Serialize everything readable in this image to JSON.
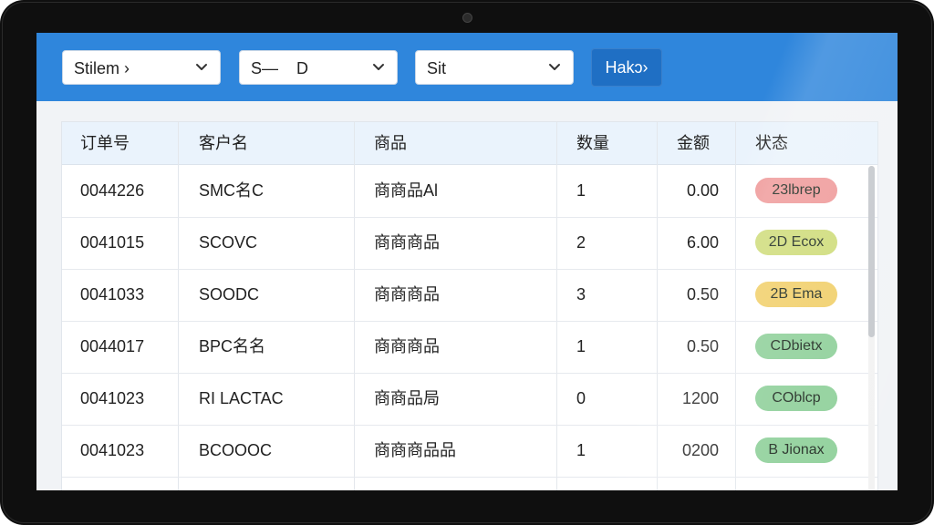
{
  "filters": {
    "filter1": "Stilem ›",
    "filter2": "S—    D",
    "filter3": "Sit",
    "action_button": "Hakɔ›"
  },
  "table": {
    "headers": [
      "订单号",
      "客户名",
      "商品",
      "数量",
      "金额",
      "状态"
    ],
    "rows": [
      {
        "order": "0044226",
        "customer": "SMC名C",
        "product": "商商品Al",
        "qty": "1",
        "amount": "0.00",
        "status": "23lbrep",
        "status_color": "#ef9a9a"
      },
      {
        "order": "0041015",
        "customer": "SCOVC",
        "product": "商商商品",
        "qty": "2",
        "amount": "6.00",
        "status": "2D Ecox",
        "status_color": "#cfdc7a"
      },
      {
        "order": "0041033",
        "customer": "SOODC",
        "product": "商商商品",
        "qty": "3",
        "amount": "0.50",
        "status": "2B Ema",
        "status_color": "#f1cf6a"
      },
      {
        "order": "0044017",
        "customer": "BPC名名",
        "product": "商商商品",
        "qty": "1",
        "amount": "0.50",
        "status": "CDbietx",
        "status_color": "#8fd09a"
      },
      {
        "order": "0041023",
        "customer": "RI LACTAC",
        "product": "商商品局",
        "qty": "0",
        "amount": "1200",
        "status": "COblcp",
        "status_color": "#8fd09a"
      },
      {
        "order": "0041023",
        "customer": "BCOOOC",
        "product": "商商商品品",
        "qty": "1",
        "amount": "0200",
        "status": "B Jionax",
        "status_color": "#8fd09a"
      }
    ]
  },
  "colors": {
    "toolbar": "#2f86dc",
    "primary_button": "#1f6fc4",
    "header_row": "#eaf3fc"
  }
}
